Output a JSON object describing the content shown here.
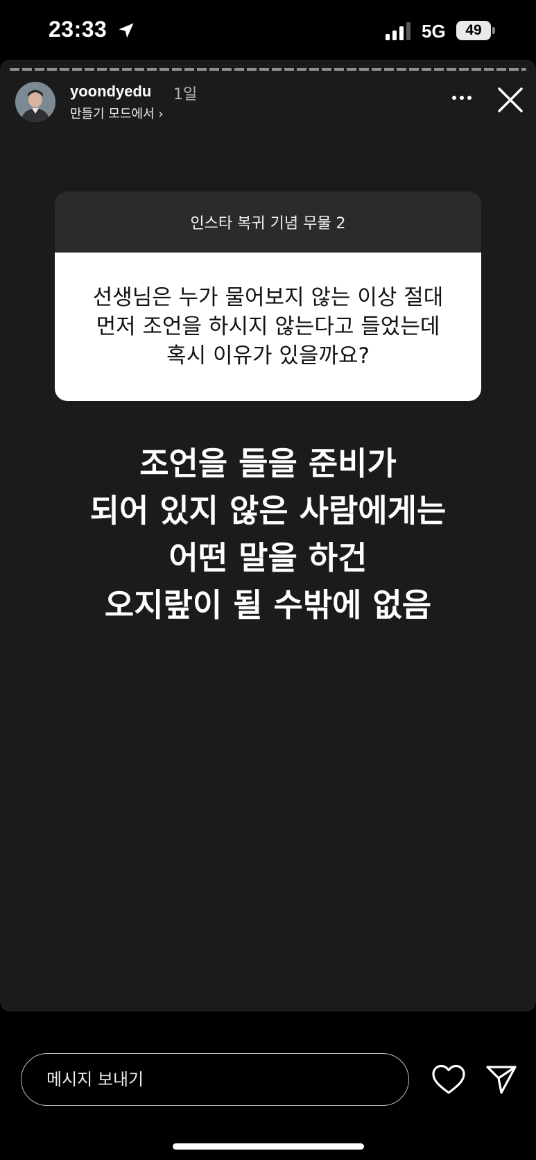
{
  "status_bar": {
    "time": "23:33",
    "network": "5G",
    "battery": "49"
  },
  "story": {
    "username": "yoondyedu",
    "time_ago": "1일",
    "create_mode": "만들기 모드에서 ›",
    "question": {
      "header": "인스타 복귀 기념 무물 2",
      "text": "선생님은 누가 물어보지 않는 이상 절대\n먼저 조언을 하시지 않는다고 들었는데\n혹시 이유가 있을까요?"
    },
    "answer": "조언을 들을 준비가\n되어 있지 않은 사람에게는\n어떤 말을 하건\n오지랖이 될 수밖에 없음"
  },
  "bottom_bar": {
    "message_placeholder": "메시지 보내기"
  },
  "icons": {
    "location": "location-arrow-icon",
    "signal": "cellular-signal-icon",
    "more": "more-options-icon",
    "close": "close-icon",
    "like": "heart-icon",
    "share": "send-icon"
  }
}
